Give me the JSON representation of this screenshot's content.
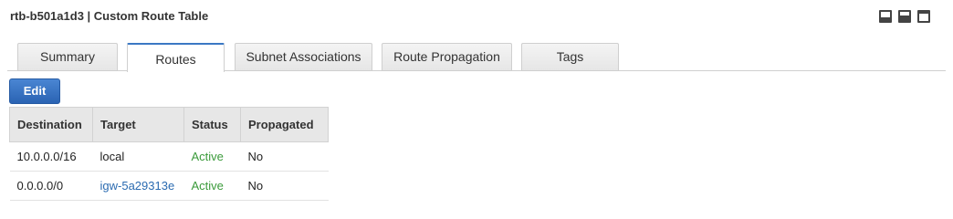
{
  "header": {
    "title": "rtb-b501a1d3 | Custom Route Table"
  },
  "view_icons": [
    "layout-bottom-icon",
    "layout-split-icon",
    "layout-full-icon"
  ],
  "tabs": [
    {
      "label": "Summary",
      "active": false
    },
    {
      "label": "Routes",
      "active": true
    },
    {
      "label": "Subnet Associations",
      "active": false
    },
    {
      "label": "Route Propagation",
      "active": false
    },
    {
      "label": "Tags",
      "active": false
    }
  ],
  "toolbar": {
    "edit_label": "Edit"
  },
  "routes_table": {
    "columns": [
      "Destination",
      "Target",
      "Status",
      "Propagated"
    ],
    "rows": [
      {
        "destination": "10.0.0.0/16",
        "target": "local",
        "status": "Active",
        "propagated": "No"
      },
      {
        "destination": "0.0.0.0/0",
        "target": "igw-5a29313e",
        "status": "Active",
        "propagated": "No"
      }
    ]
  },
  "colors": {
    "accent": "#3b78c4",
    "button": "#2a63b3",
    "status_active": "#3a9a3a",
    "link": "#2b6bb1"
  }
}
